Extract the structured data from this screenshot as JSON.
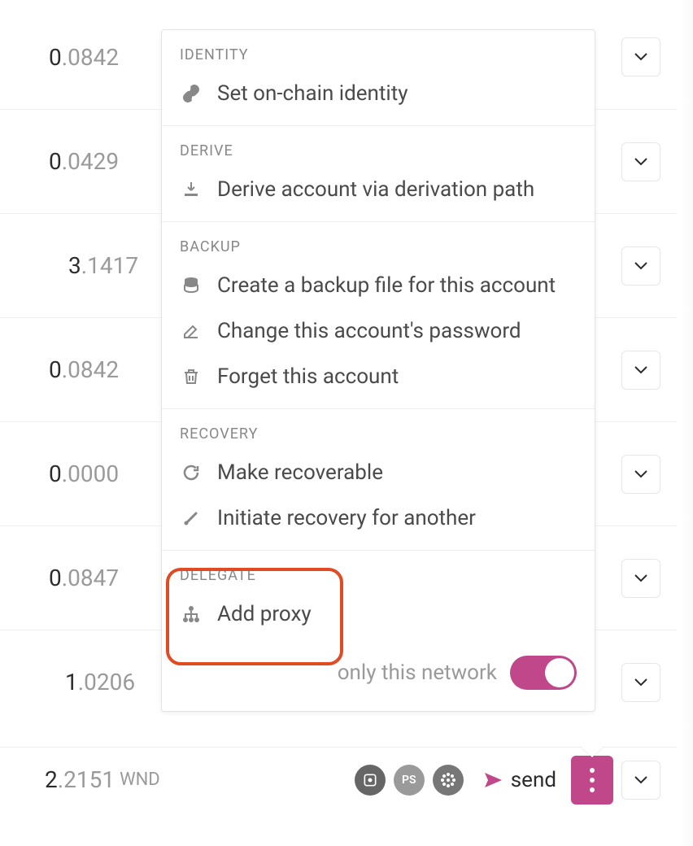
{
  "rows": [
    {
      "int": "0",
      "frac": ".0842"
    },
    {
      "int": "0",
      "frac": ".0429"
    },
    {
      "int": "3",
      "frac": ".1417"
    },
    {
      "int": "0",
      "frac": ".0842"
    },
    {
      "int": "0",
      "frac": ".0000"
    },
    {
      "int": "0",
      "frac": ".0847"
    },
    {
      "int": "1",
      "frac": ".0206"
    }
  ],
  "totals": {
    "int": "2",
    "frac": ".2151",
    "unit": "WND",
    "send_label": "send"
  },
  "badges": {
    "b1": "",
    "b2": "PS"
  },
  "menu": {
    "sections": [
      {
        "header": "IDENTITY",
        "items": [
          {
            "icon": "link-icon",
            "label": "Set on-chain identity"
          }
        ]
      },
      {
        "header": "DERIVE",
        "items": [
          {
            "icon": "download-icon",
            "label": "Derive account via derivation path"
          }
        ]
      },
      {
        "header": "BACKUP",
        "items": [
          {
            "icon": "database-icon",
            "label": "Create a backup file for this account"
          },
          {
            "icon": "edit-icon",
            "label": "Change this account's password"
          },
          {
            "icon": "trash-icon",
            "label": "Forget this account"
          }
        ]
      },
      {
        "header": "RECOVERY",
        "items": [
          {
            "icon": "refresh-icon",
            "label": "Make recoverable"
          },
          {
            "icon": "wand-icon",
            "label": "Initiate recovery for another"
          }
        ]
      },
      {
        "header": "DELEGATE",
        "items": [
          {
            "icon": "sitemap-icon",
            "label": "Add proxy"
          }
        ]
      }
    ],
    "footer_label": "only this network",
    "toggle_on": true
  }
}
